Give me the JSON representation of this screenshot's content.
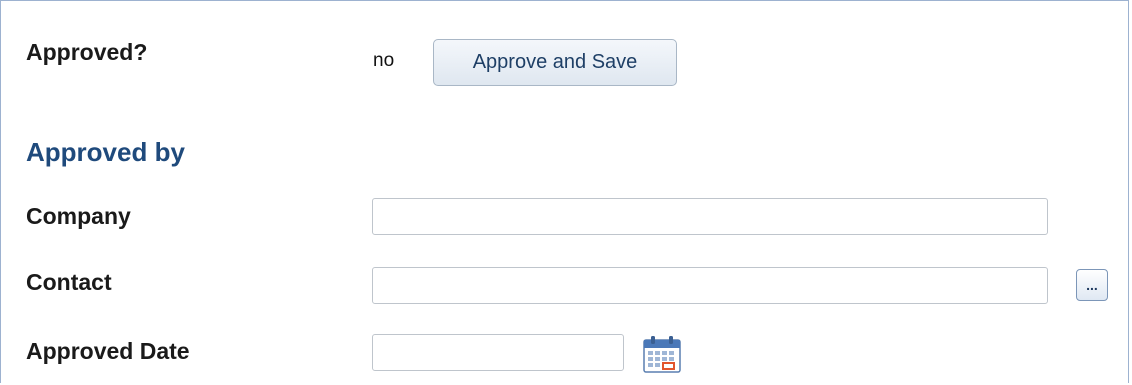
{
  "approval": {
    "label": "Approved?",
    "status_value": "no",
    "approve_button_label": "Approve and Save"
  },
  "section": {
    "title": "Approved by"
  },
  "fields": {
    "company": {
      "label": "Company",
      "value": ""
    },
    "contact": {
      "label": "Contact",
      "value": "",
      "lookup_button_label": "..."
    },
    "approved_date": {
      "label": "Approved Date",
      "value": ""
    }
  },
  "icons": {
    "lookup": "ellipsis-lookup-icon",
    "calendar": "calendar-icon"
  },
  "colors": {
    "section_title": "#1f4a7c",
    "button_text": "#1e3f66",
    "frame_border": "#9db2d0"
  }
}
